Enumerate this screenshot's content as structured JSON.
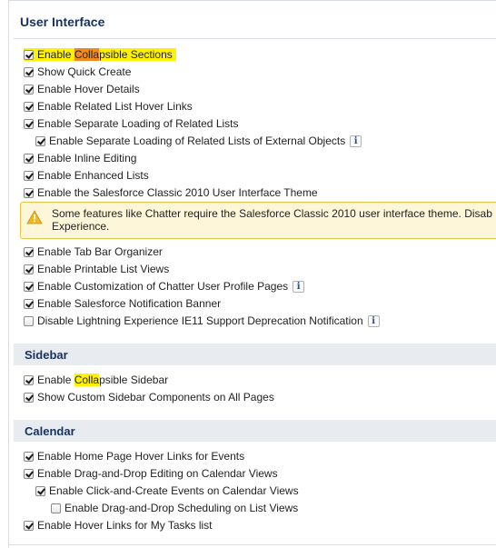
{
  "ui": {
    "title": "User Interface",
    "settings": [
      {
        "label_pre": "Enable ",
        "label_hl": "Colla",
        "label_post": "psible Sections",
        "checked": true
      },
      {
        "label": "Show Quick Create",
        "checked": true
      },
      {
        "label": "Enable Hover Details",
        "checked": true
      },
      {
        "label": "Enable Related List Hover Links",
        "checked": true
      },
      {
        "label": "Enable Separate Loading of Related Lists",
        "checked": true
      },
      {
        "label": "Enable Separate Loading of Related Lists of External Objects",
        "checked": true,
        "info": "i"
      },
      {
        "label": "Enable Inline Editing",
        "checked": true
      },
      {
        "label": "Enable Enhanced Lists",
        "checked": true
      },
      {
        "label": "Enable the Salesforce Classic 2010 User Interface Theme",
        "checked": true
      }
    ],
    "warning": {
      "line1": "Some features like Chatter require the Salesforce Classic 2010 user interface theme. Disab",
      "line2": "Experience."
    },
    "settings2": [
      {
        "label": "Enable Tab Bar Organizer",
        "checked": true
      },
      {
        "label": "Enable Printable List Views",
        "checked": true
      },
      {
        "label": "Enable Customization of Chatter User Profile Pages",
        "checked": true,
        "info": "i"
      },
      {
        "label": "Enable Salesforce Notification Banner",
        "checked": true
      },
      {
        "label": "Disable Lightning Experience IE11 Support Deprecation Notification",
        "checked": false,
        "info": "i"
      }
    ]
  },
  "sidebar": {
    "title": "Sidebar",
    "settings": [
      {
        "label_pre": "Enable ",
        "label_hl": "Colla",
        "label_post": "psible Sidebar",
        "checked": true
      },
      {
        "label": "Show Custom Sidebar Components on All Pages",
        "checked": true
      }
    ]
  },
  "calendar": {
    "title": "Calendar",
    "settings": [
      {
        "label": "Enable Home Page Hover Links for Events",
        "checked": true
      },
      {
        "label": "Enable Drag-and-Drop Editing on Calendar Views",
        "checked": true
      },
      {
        "label": "Enable Click-and-Create Events on Calendar Views",
        "checked": true
      },
      {
        "label": "Enable Drag-and-Drop Scheduling on List Views",
        "checked": false
      },
      {
        "label": "Enable Hover Links for My Tasks list",
        "checked": true
      }
    ]
  },
  "colors": {
    "highlight": "#fff200",
    "highlight_strong": "#f08a1c",
    "section_bg": "#e8ecf1",
    "warning_bg": "#fdf6d8",
    "warning_icon": "#f2b71f"
  },
  "icons": {
    "info": "info-icon",
    "warning": "warning-icon",
    "checkbox": "checkbox"
  }
}
